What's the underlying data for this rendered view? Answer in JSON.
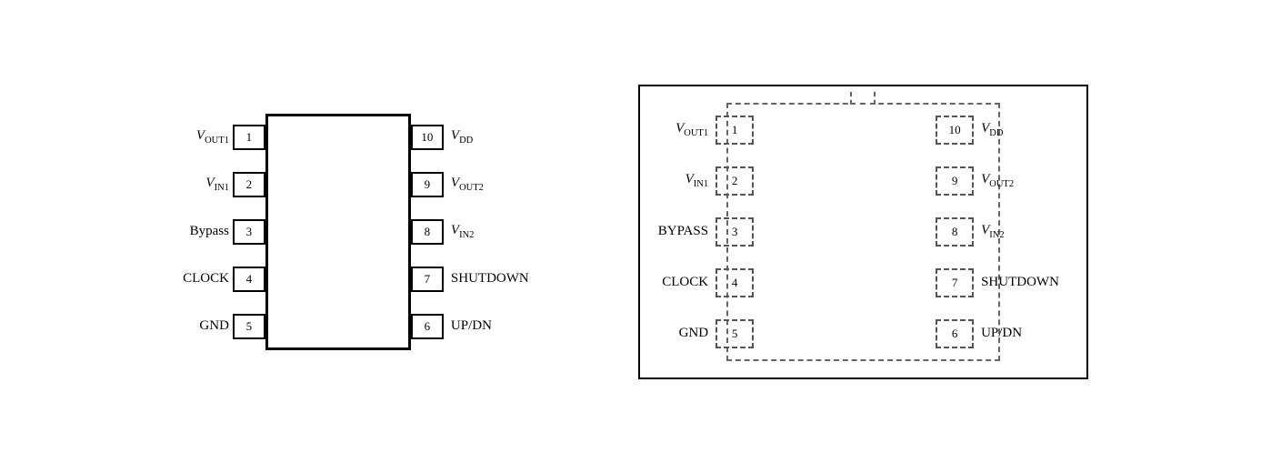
{
  "left_diagram": {
    "left_pins": [
      {
        "number": "1",
        "label_italic": "V",
        "label_sub": "OUT1"
      },
      {
        "number": "2",
        "label_italic": "V",
        "label_sub": "IN1"
      },
      {
        "number": "3",
        "label_normal": "Bypass"
      },
      {
        "number": "4",
        "label_normal": "CLOCK"
      },
      {
        "number": "5",
        "label_normal": "GND"
      }
    ],
    "right_pins": [
      {
        "number": "10",
        "label_italic": "V",
        "label_sub": "DD"
      },
      {
        "number": "9",
        "label_italic": "V",
        "label_sub": "OUT2"
      },
      {
        "number": "8",
        "label_italic": "V",
        "label_sub": "IN2"
      },
      {
        "number": "7",
        "label_normal": "SHUTDOWN"
      },
      {
        "number": "6",
        "label_normal": "UP/DN"
      }
    ]
  },
  "right_diagram": {
    "left_pins": [
      {
        "number": "1",
        "label_italic": "V",
        "label_sub": "OUT1"
      },
      {
        "number": "2",
        "label_italic": "V",
        "label_sub": "IN1"
      },
      {
        "number": "3",
        "label_normal": "BYPASS"
      },
      {
        "number": "4",
        "label_normal": "CLOCK"
      },
      {
        "number": "5",
        "label_normal": "GND"
      }
    ],
    "right_pins": [
      {
        "number": "10",
        "label_italic": "V",
        "label_sub": "DD"
      },
      {
        "number": "9",
        "label_italic": "V",
        "label_sub": "OUT2"
      },
      {
        "number": "8",
        "label_italic": "V",
        "label_sub": "IN2"
      },
      {
        "number": "7",
        "label_normal": "SHUTDOWN"
      },
      {
        "number": "6",
        "label_normal": "UP/DN"
      }
    ]
  }
}
